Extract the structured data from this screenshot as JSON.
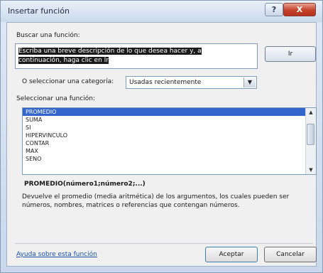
{
  "window": {
    "title": "Insertar función",
    "help_glyph": "?",
    "close_glyph": "X"
  },
  "search": {
    "label": "Buscar una función:",
    "value_line1": "Escriba una breve descripción de lo que desea hacer y, a",
    "value_line2": "continuación, haga clic en Ir",
    "go_label": "Ir"
  },
  "category": {
    "label": "O seleccionar una categoría:",
    "selected": "Usadas recientemente",
    "arrow_icon": "chevron-down-icon"
  },
  "functions": {
    "label": "Seleccionar una función:",
    "items": [
      "PROMEDIO",
      "SUMA",
      "SI",
      "HIPERVINCULO",
      "CONTAR",
      "MAX",
      "SENO"
    ],
    "selected_index": 0
  },
  "details": {
    "syntax": "PROMEDIO(número1;número2;...)",
    "description": "Devuelve el promedio (media aritmética) de los argumentos, los cuales pueden ser números, nombres, matrices o referencias que contengan números."
  },
  "footer": {
    "help_link": "Ayuda sobre esta función",
    "ok_label": "Aceptar",
    "cancel_label": "Cancelar"
  },
  "colors": {
    "selection": "#3366cc",
    "close_button": "#c4412c",
    "link": "#1a4fb0"
  }
}
